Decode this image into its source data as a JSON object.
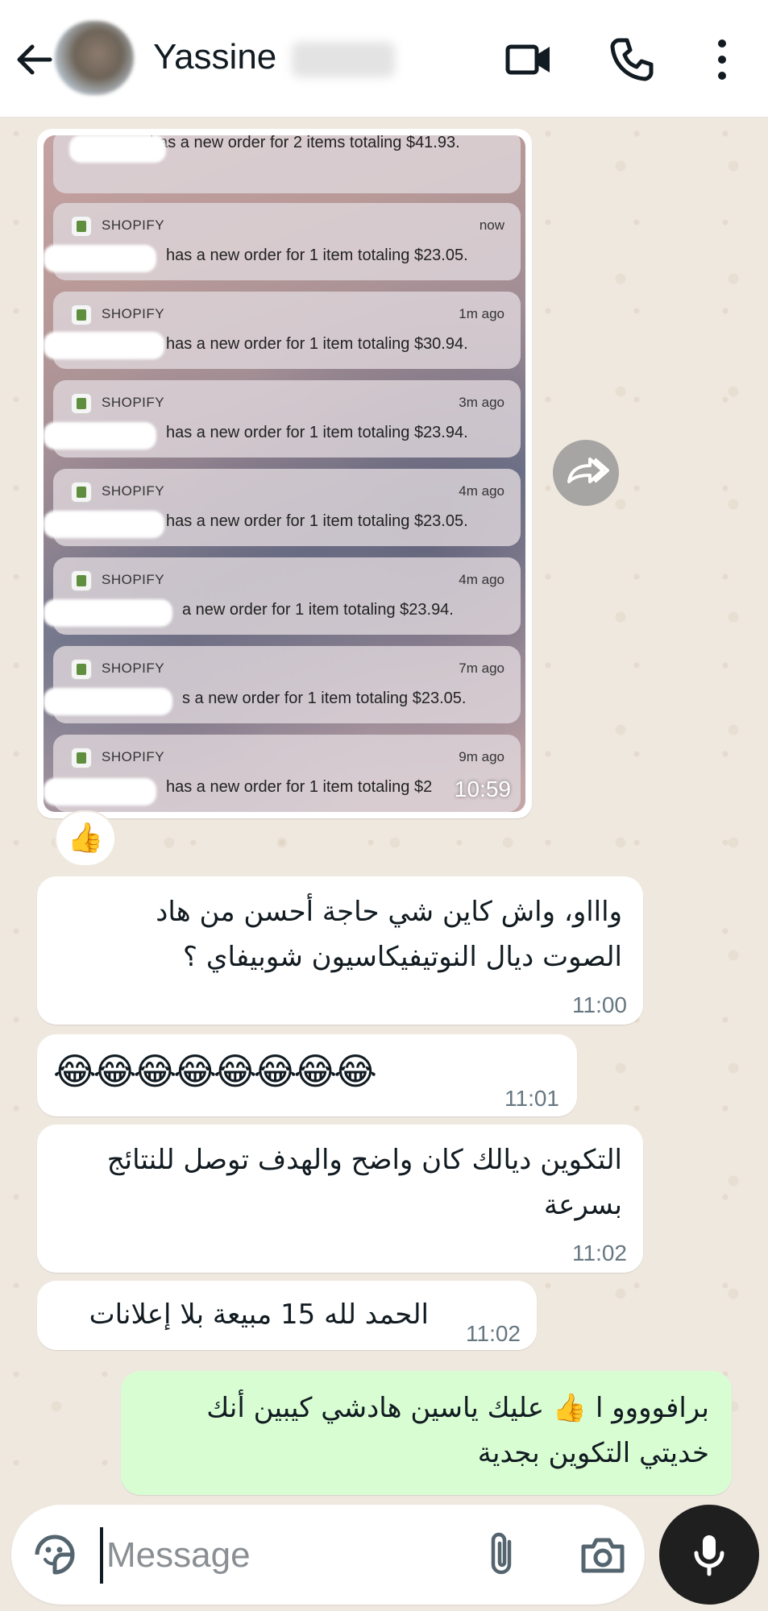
{
  "header": {
    "contact_name": "Yassine",
    "icons": [
      "back-arrow-icon",
      "video-call-icon",
      "phone-icon",
      "more-vert-icon"
    ]
  },
  "image_message": {
    "time": "10:59",
    "notifications": [
      {
        "app": "",
        "time": "",
        "text": "has a new order for 2 items totaling $41.93."
      },
      {
        "app": "SHOPIFY",
        "time": "now",
        "text": "has a new order for 1 item totaling $23.05."
      },
      {
        "app": "SHOPIFY",
        "time": "1m ago",
        "text": "has a new order for 1 item totaling $30.94."
      },
      {
        "app": "SHOPIFY",
        "time": "3m ago",
        "text": "has a new order for 1 item totaling $23.94."
      },
      {
        "app": "SHOPIFY",
        "time": "4m ago",
        "text": "has a new order for 1 item totaling $23.05."
      },
      {
        "app": "SHOPIFY",
        "time": "4m ago",
        "text": "a new order for 1 item totaling $23.94."
      },
      {
        "app": "SHOPIFY",
        "time": "7m ago",
        "text": "s a new order for 1 item totaling $23.05."
      },
      {
        "app": "SHOPIFY",
        "time": "9m ago",
        "text": "has a new order for 1 item totaling $2"
      }
    ],
    "reaction": "👍"
  },
  "messages": [
    {
      "text": "واااو، واش كاين شي حاجة أحسن من هاد الصوت ديال النوتيفيكاسيون شوبيفاي ؟",
      "time": "11:00",
      "direction": "in"
    },
    {
      "text": "😂😂😂😂😂😂😂😂",
      "time": "11:01",
      "direction": "in"
    },
    {
      "text": "التكوين ديالك كان واضح والهدف توصل للنتائج بسرعة",
      "time": "11:02",
      "direction": "in"
    },
    {
      "text": "الحمد لله 15 مبيعة بلا إعلانات",
      "time": "11:02",
      "direction": "in"
    },
    {
      "text": "برافوووو ا 👍 عليك ياسين هادشي كيبين أنك خديتي التكوين بجدية",
      "time": "",
      "direction": "out"
    }
  ],
  "composer": {
    "placeholder": "Message",
    "icons": [
      "sticker-icon",
      "attach-icon",
      "camera-icon",
      "mic-icon"
    ]
  },
  "colors": {
    "background": "#efeae2",
    "incoming_bubble": "#ffffff",
    "outgoing_bubble": "#d9fdd3",
    "mic_button": "#1f1f1f"
  }
}
